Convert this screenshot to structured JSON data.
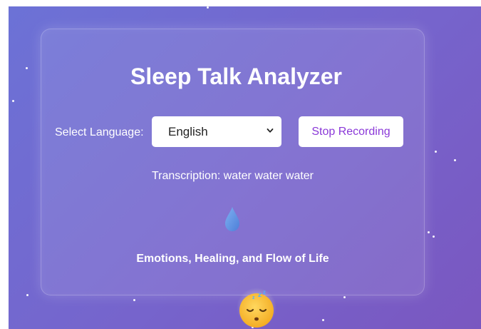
{
  "app": {
    "title": "Sleep Talk Analyzer"
  },
  "language": {
    "label": "Select Language:",
    "selected": "English"
  },
  "controls": {
    "stop_label": "Stop Recording"
  },
  "transcription": {
    "text": "Transcription: water water water"
  },
  "emotion": {
    "icon": "water-drop-icon",
    "caption": "Emotions, Healing, and Flow of Life"
  },
  "mascot": {
    "icon": "sleeping-face-icon"
  },
  "colors": {
    "background_start": "#6c72d6",
    "background_end": "#7a57c0",
    "button_text": "#8a38d8",
    "drop": "#5b8de6"
  }
}
